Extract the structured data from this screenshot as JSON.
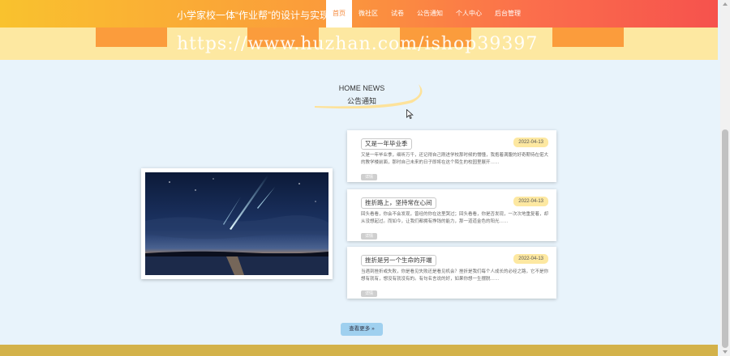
{
  "header": {
    "site_title": "小学家校一体“作业帮”的设计与实现",
    "nav": [
      "首页",
      "微社区",
      "试卷",
      "公告通知",
      "个人中心",
      "后台管理"
    ],
    "active_nav": "首页"
  },
  "watermark": "https://www.huzhan.com/ishop39397",
  "section": {
    "title_en": "HOME NEWS",
    "title_cn": "公告通知"
  },
  "news": [
    {
      "title": "又是一年毕业季",
      "date": "2022-04-13",
      "desc": "又是一年毕业季，细听万千，还记得自己刚进学校那时候的懵懂，我抱着满腹的好奇期待在偌大的教学楼前面，那时自己未来的日子即将在这个陌生的校园里展开……",
      "more": "详情"
    },
    {
      "title": "挫折路上，坚持常在心间",
      "date": "2022-04-13",
      "desc": "回头看看，你会不会发现，曾经的你在这里哭过；回头看看，你是否发现，一次次地重复着，却从没想起过。而如今，让我们都拥有挣钱的能力，那一道道金色的阳光……",
      "more": "详情"
    },
    {
      "title": "挫折是另一个生命的开端",
      "date": "2022-04-13",
      "desc": "当遇到挫折或失败，你是看见失败还是看见机会？挫折是我们每个人成长的必经之路，它不是你想有就有，想没有就没有的。有句名言说的好，如果你想一生摆脱……",
      "more": "详情"
    }
  ],
  "more_button": "查看更多 »",
  "colors": {
    "accent": "#fb9c3c",
    "band": "#fde8a1",
    "background": "#e8f3fb",
    "footer": "#d3b24a"
  }
}
